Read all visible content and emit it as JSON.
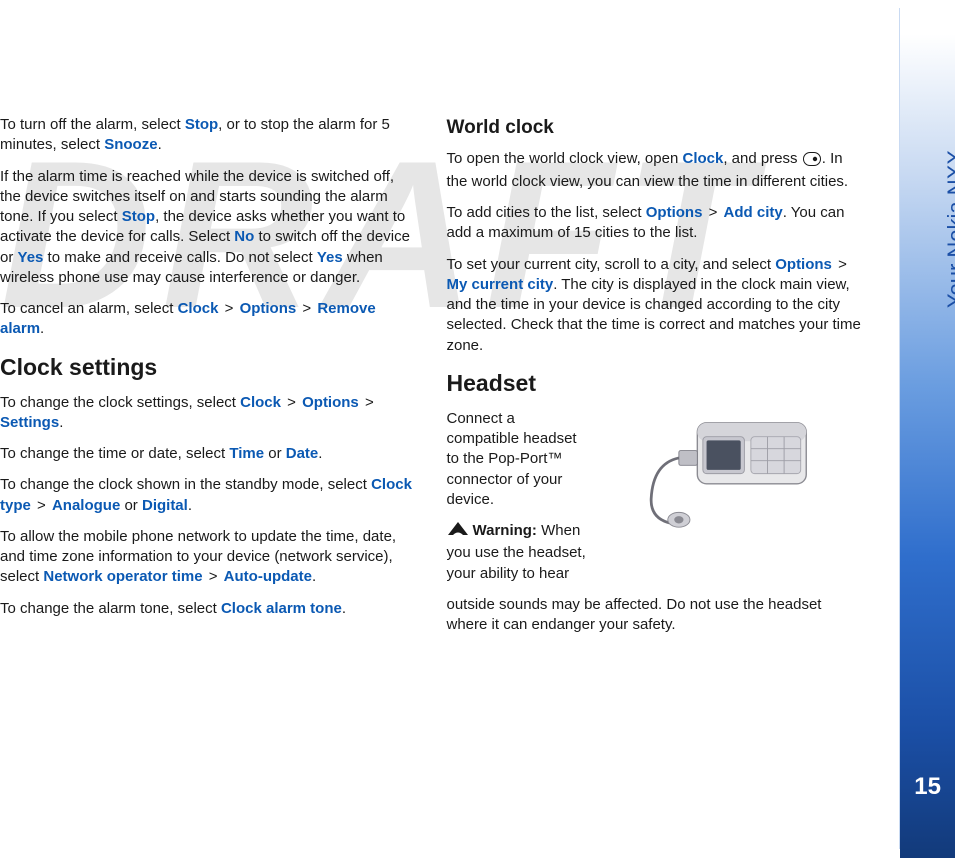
{
  "watermark": "DRAFT",
  "side_label": "Your Nokia NXX",
  "page_number": "15",
  "col1": {
    "p1_a": "To turn off the alarm, select ",
    "p1_stop": "Stop",
    "p1_b": ", or to stop the alarm for 5 minutes, select ",
    "p1_snooze": "Snooze",
    "p1_c": ".",
    "p2_a": "If the alarm time is reached while the device is switched off, the device switches itself on and starts sounding the alarm tone. If you select ",
    "p2_stop": "Stop",
    "p2_b": ", the device asks whether you want to activate the device for calls. Select ",
    "p2_no": "No",
    "p2_c": " to switch off the device or ",
    "p2_yes": "Yes",
    "p2_d": " to make and receive calls. Do not select ",
    "p2_yes2": "Yes",
    "p2_e": " when wireless phone use may cause interference or danger.",
    "p3_a": "To cancel an alarm, select ",
    "p3_clock": "Clock",
    "p3_opts": "Options",
    "p3_rem": "Remove alarm",
    "p3_b": ".",
    "h_settings": "Clock settings",
    "p4_a": "To change the clock settings, select ",
    "p4_clock": "Clock",
    "p4_opts": "Options",
    "p4_set": "Settings",
    "p4_b": ".",
    "p5_a": "To change the time or date, select ",
    "p5_time": "Time",
    "p5_or": " or ",
    "p5_date": "Date",
    "p5_b": ".",
    "p6_a": "To change the clock shown in the standby mode, select ",
    "p6_ct": "Clock type",
    "p6_an": "Analogue",
    "p6_or": " or ",
    "p6_dg": "Digital",
    "p6_b": ".",
    "p7_a": "To allow the mobile phone network to update the time, date, and time zone information to your device (network service), select ",
    "p7_not": "Network operator time",
    "p7_au": "Auto-update",
    "p7_b": ".",
    "p8_a": "To change the alarm tone, select ",
    "p8_cat": "Clock alarm tone",
    "p8_b": "."
  },
  "col2": {
    "h_world": "World clock",
    "p1_a": "To open the world clock view, open ",
    "p1_clock": "Clock",
    "p1_b": ", and press ",
    "p1_c": ". In the world clock view, you can view the time in different cities.",
    "p2_a": "To add cities to the list, select ",
    "p2_opts": "Options",
    "p2_add": "Add city",
    "p2_b": ". You can add a maximum of 15 cities to the list.",
    "p3_a": "To set your current city, scroll to a city, and select ",
    "p3_opts": "Options",
    "p3_mcc": "My current city",
    "p3_b": ". The city is displayed in the clock main view, and the time in your device is changed according to the city selected. Check that the time is correct and matches your time zone.",
    "h_headset": "Headset",
    "hs_text": "Connect a compatible headset to the Pop-Port™ connector of your device.",
    "warn_label": "Warning:",
    "warn_a": " When you use the headset, your ability to hear",
    "warn_b": "outside sounds may be affected. Do not use the headset where it can endanger your safety."
  }
}
